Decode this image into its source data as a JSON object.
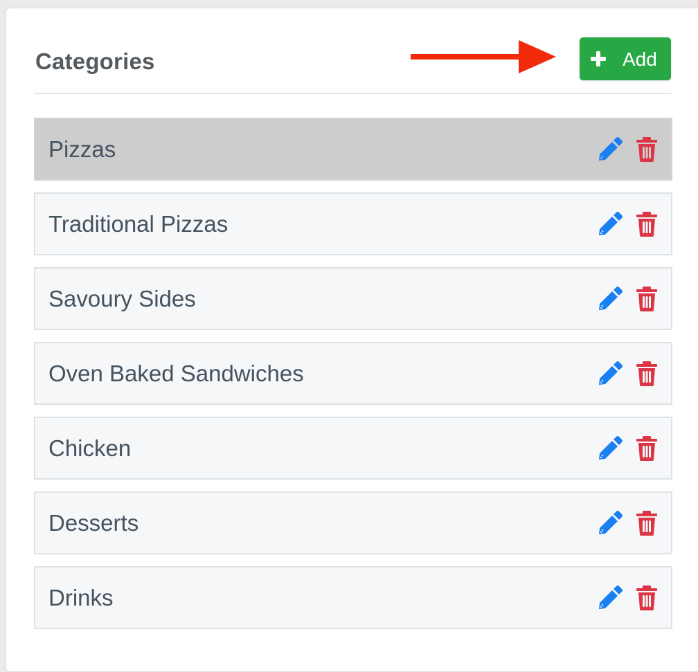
{
  "header": {
    "title": "Categories",
    "add_label": "Add"
  },
  "categories": [
    {
      "label": "Pizzas",
      "selected": true
    },
    {
      "label": "Traditional Pizzas",
      "selected": false
    },
    {
      "label": "Savoury Sides",
      "selected": false
    },
    {
      "label": "Oven Baked Sandwiches",
      "selected": false
    },
    {
      "label": "Chicken",
      "selected": false
    },
    {
      "label": "Desserts",
      "selected": false
    },
    {
      "label": "Drinks",
      "selected": false
    }
  ],
  "icons": {
    "add": "plus-icon",
    "edit": "pencil-icon",
    "delete": "trash-icon",
    "annotation": "arrow-right-icon"
  },
  "colors": {
    "accent_add": "#28a745",
    "edit_icon": "#1a7ff0",
    "delete_icon": "#dc3545",
    "annotation_arrow": "#f22a0c",
    "selected_row": "#cdcdcd"
  }
}
